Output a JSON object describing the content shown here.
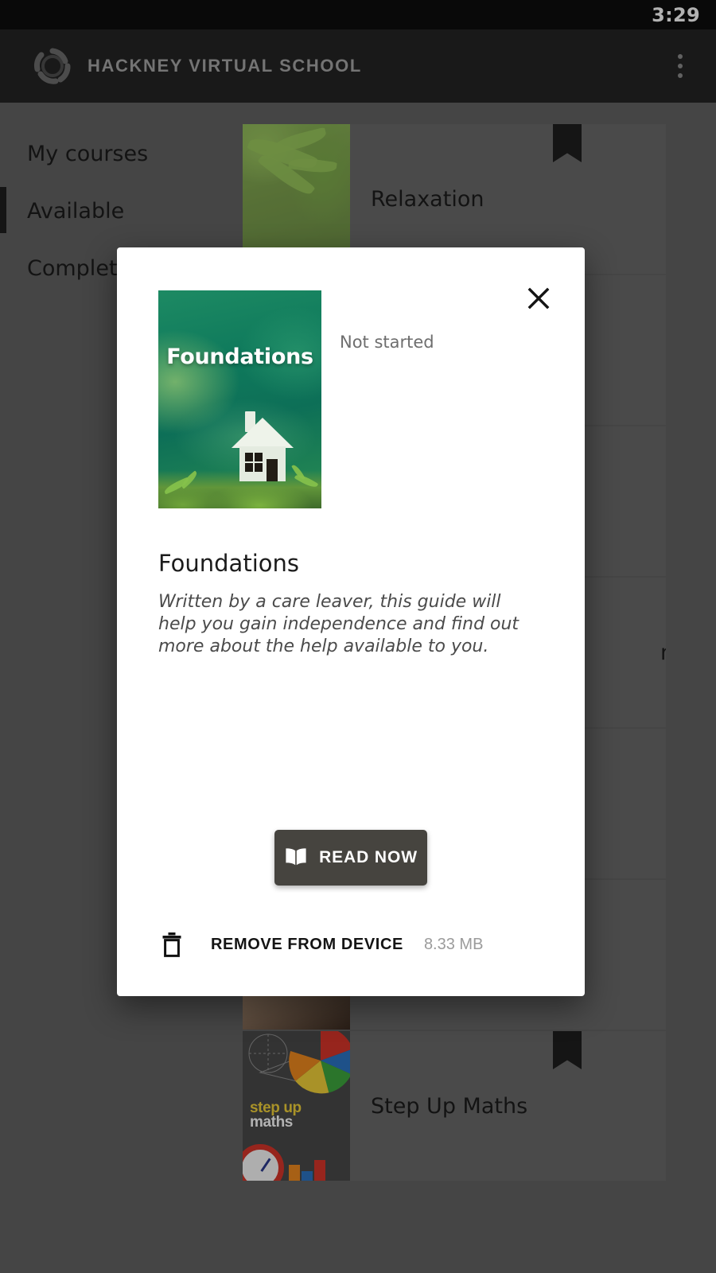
{
  "status_bar": {
    "time": "3:29"
  },
  "app_bar": {
    "title": "HACKNEY VIRTUAL SCHOOL",
    "logo_icon": "swirl-circle-logo",
    "overflow_icon": "more-vertical-icon"
  },
  "tabs": [
    {
      "label": "My courses",
      "selected": false
    },
    {
      "label": "Available",
      "selected": true
    },
    {
      "label": "Completed",
      "selected": false
    }
  ],
  "course_list": [
    {
      "name": "Relaxation",
      "thumb": "leaves-green",
      "thumb_caption": "Relaxation",
      "bookmarked": true
    },
    {
      "name": "",
      "thumb": "soft-gray",
      "bookmarked": false
    },
    {
      "name": "",
      "thumb": "soft-gray",
      "bookmarked": false
    },
    {
      "name": "ment",
      "thumb": "soft-gray",
      "bookmarked": false
    },
    {
      "name": "",
      "thumb": "soft-gray",
      "bookmarked": false
    },
    {
      "name": "",
      "thumb": "skin-hand",
      "bookmarked": false
    },
    {
      "name": "Step Up Maths",
      "thumb": "step-up-maths",
      "bookmarked": true
    }
  ],
  "dialog": {
    "close_icon": "close-x-icon",
    "cover": {
      "title": "Foundations",
      "art": "white-house-on-grass-green-gradient"
    },
    "status": "Not started",
    "title": "Foundations",
    "description": "Written by a care leaver, this guide will help you gain independence and find out more about the help available to you.",
    "read_button": {
      "label": "READ NOW",
      "icon": "open-book-icon"
    },
    "remove_row": {
      "label": "REMOVE FROM DEVICE",
      "size": "8.33 MB",
      "icon": "trash-can-icon"
    }
  },
  "colors": {
    "status_bar_bg": "#0d0d0d",
    "app_bar_bg": "#242424",
    "app_title": "#a6a6a6",
    "scrim": "#636363",
    "dialog_bg": "#ffffff",
    "button_bg": "#46443f",
    "cover_green": "#0f7a5c",
    "muted_text": "#9b9b9b"
  }
}
